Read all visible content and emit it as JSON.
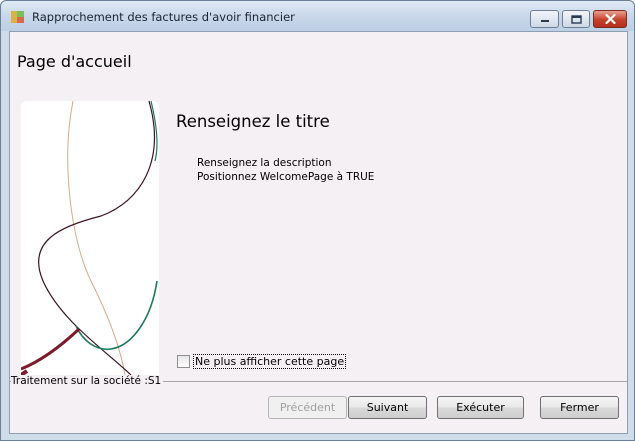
{
  "window": {
    "title": "Rapprochement des factures d'avoir financier",
    "controls": {
      "minimize": "minimize-icon",
      "maximize": "maximize-icon",
      "close": "close-icon"
    }
  },
  "page": {
    "title": "Page d'accueil"
  },
  "content": {
    "title": "Renseignez le titre",
    "description_lines": [
      "Renseignez la description",
      "Positionnez WelcomePage à TRUE"
    ]
  },
  "options": {
    "dont_show_again_label": "Ne plus afficher cette page",
    "dont_show_again_checked": false
  },
  "status": {
    "text": "Traitement sur la société :S1"
  },
  "buttons": {
    "previous": "Précédent",
    "next": "Suivant",
    "execute": "Exécuter",
    "close": "Fermer"
  },
  "colors": {
    "curve_dark_red": "#7d1a2c",
    "curve_teal": "#1f7a5c",
    "curve_tan": "#d9a98a",
    "curve_dark": "#3b1428"
  }
}
